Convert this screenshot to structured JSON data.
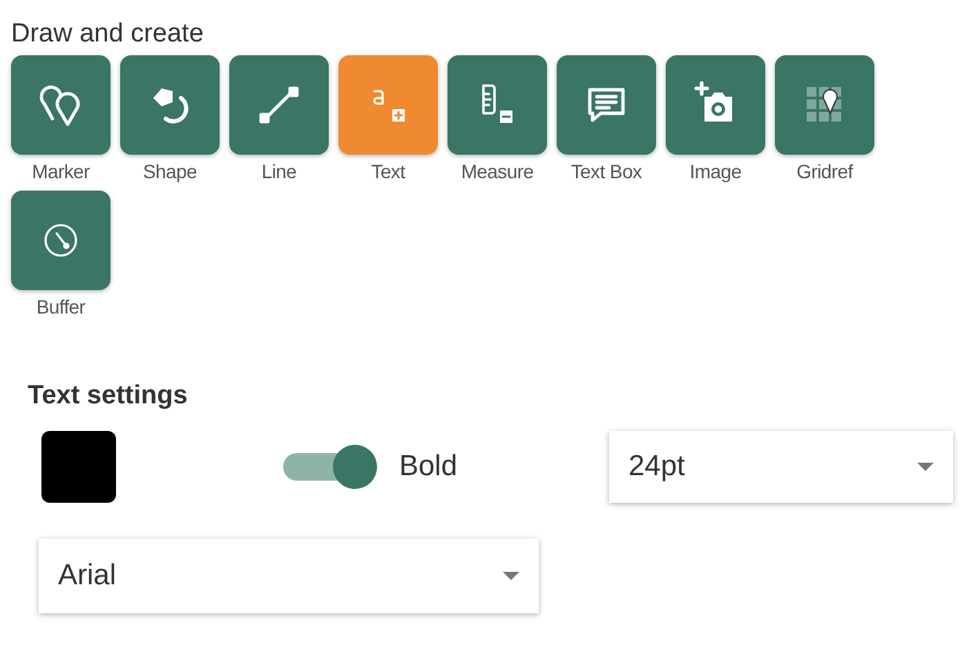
{
  "title": "Draw and create",
  "tools": [
    {
      "label": "Marker",
      "kind": "marker",
      "selected": false
    },
    {
      "label": "Shape",
      "kind": "shape",
      "selected": false
    },
    {
      "label": "Line",
      "kind": "line",
      "selected": false
    },
    {
      "label": "Text",
      "kind": "text",
      "selected": true
    },
    {
      "label": "Measure",
      "kind": "measure",
      "selected": false
    },
    {
      "label": "Text Box",
      "kind": "textbox",
      "selected": false
    },
    {
      "label": "Image",
      "kind": "image",
      "selected": false
    },
    {
      "label": "Gridref",
      "kind": "gridref",
      "selected": false
    },
    {
      "label": "Buffer",
      "kind": "buffer",
      "selected": false
    }
  ],
  "settings": {
    "heading": "Text settings",
    "color": "#000000",
    "bold": {
      "label": "Bold",
      "on": true
    },
    "size": {
      "value": "24pt"
    },
    "font": {
      "value": "Arial"
    }
  }
}
